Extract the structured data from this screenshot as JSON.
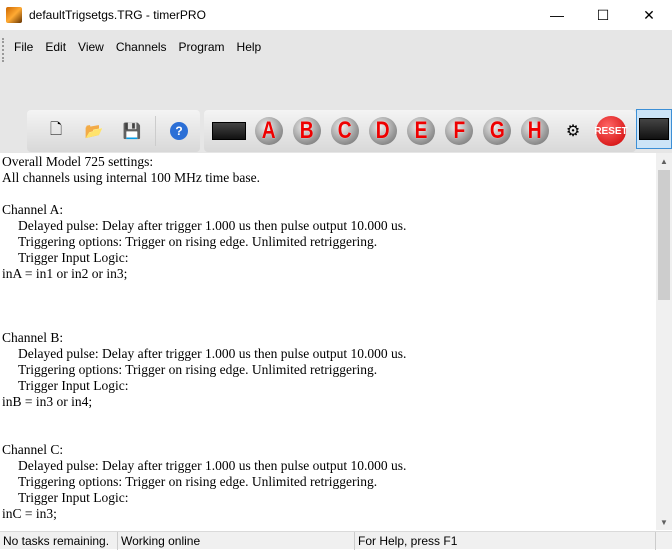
{
  "window": {
    "title": "defaultTrigsetgs.TRG - timerPRO",
    "minimize": "—",
    "maximize": "☐",
    "close": "✕"
  },
  "menu": [
    "File",
    "Edit",
    "View",
    "Channels",
    "Program",
    "Help"
  ],
  "toolbar": {
    "file_buttons": [
      {
        "name": "new-file-icon",
        "glyph": "🗋"
      },
      {
        "name": "open-folder-icon",
        "glyph": "📂"
      },
      {
        "name": "save-disk-icon",
        "glyph": "💾"
      }
    ],
    "help_glyph": "?",
    "channels": [
      "A",
      "B",
      "C",
      "D",
      "E",
      "F",
      "G",
      "H"
    ],
    "reset_label": "RESET"
  },
  "content": {
    "lines": [
      {
        "t": "Overall Model 725 settings:",
        "i": 0
      },
      {
        "t": "All channels using internal 100 MHz time base.",
        "i": 0
      },
      {
        "t": "",
        "i": 0
      },
      {
        "t": "Channel A:",
        "i": 0
      },
      {
        "t": "Delayed pulse: Delay after trigger 1.000 us then pulse output 10.000 us.",
        "i": 1
      },
      {
        "t": "Triggering options: Trigger on rising edge. Unlimited retriggering.",
        "i": 1
      },
      {
        "t": "Trigger Input Logic:",
        "i": 1
      },
      {
        "t": "inA = in1 or in2 or in3;",
        "i": 0
      },
      {
        "t": "",
        "i": 0
      },
      {
        "t": "",
        "i": 0
      },
      {
        "t": "",
        "i": 0
      },
      {
        "t": "Channel B:",
        "i": 0
      },
      {
        "t": "Delayed pulse: Delay after trigger 1.000 us then pulse output 10.000 us.",
        "i": 1
      },
      {
        "t": "Triggering options: Trigger on rising edge. Unlimited retriggering.",
        "i": 1
      },
      {
        "t": "Trigger Input Logic:",
        "i": 1
      },
      {
        "t": "inB = in3 or in4;",
        "i": 0
      },
      {
        "t": "",
        "i": 0
      },
      {
        "t": "",
        "i": 0
      },
      {
        "t": "Channel C:",
        "i": 0
      },
      {
        "t": "Delayed pulse: Delay after trigger 1.000 us then pulse output 10.000 us.",
        "i": 1
      },
      {
        "t": "Triggering options: Trigger on rising edge. Unlimited retriggering.",
        "i": 1
      },
      {
        "t": "Trigger Input Logic:",
        "i": 1
      },
      {
        "t": "inC = in3;",
        "i": 0
      }
    ]
  },
  "status": {
    "tasks": "No tasks remaining.",
    "connection": "Working online",
    "help": "For Help, press F1"
  }
}
